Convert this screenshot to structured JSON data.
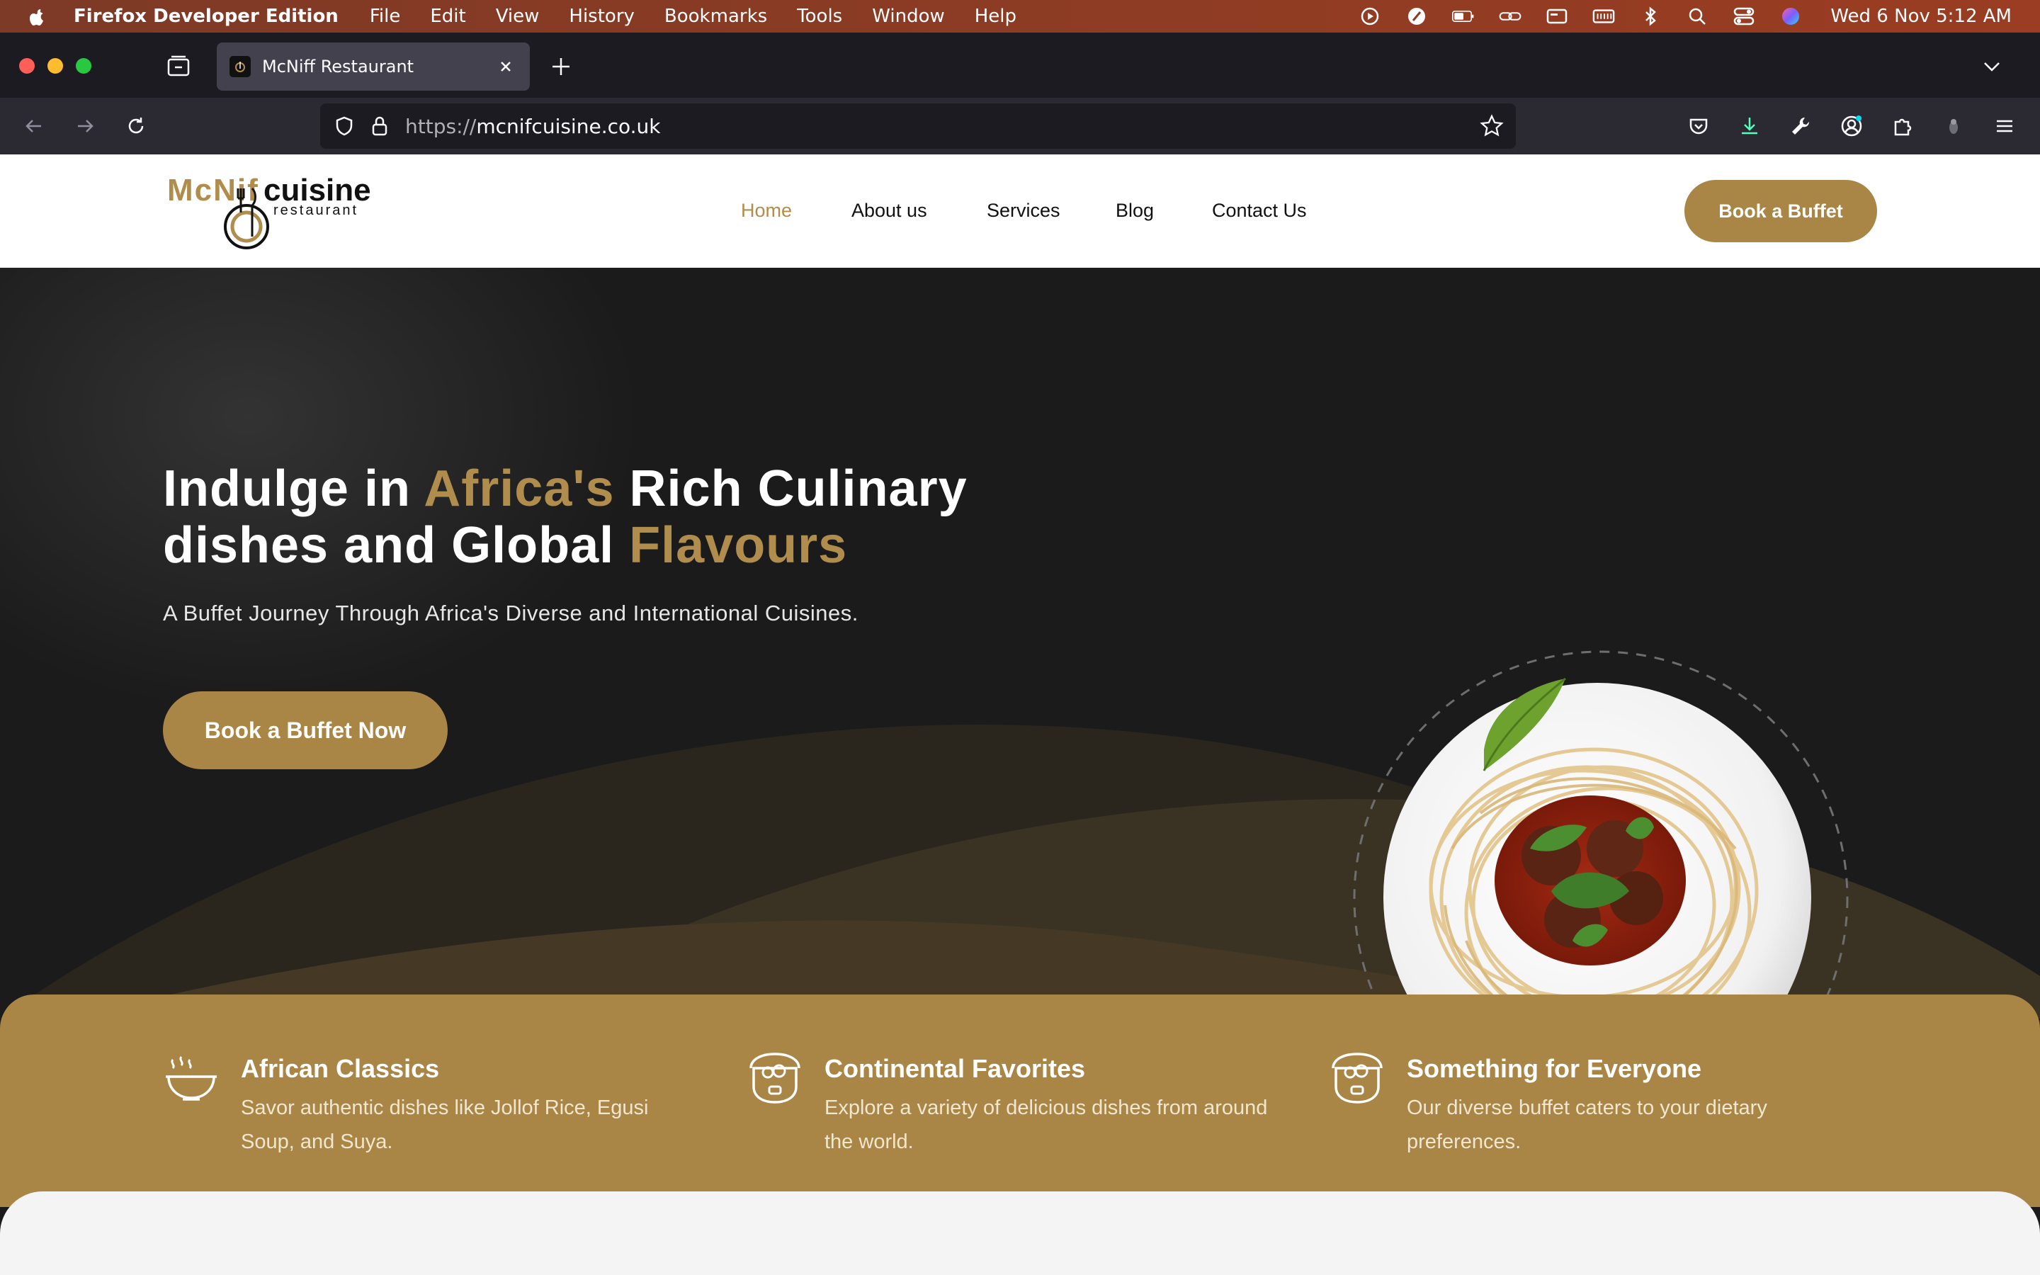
{
  "menubar": {
    "app_name": "Firefox Developer Edition",
    "items": [
      "File",
      "Edit",
      "View",
      "History",
      "Bookmarks",
      "Tools",
      "Window",
      "Help"
    ],
    "clock": "Wed 6 Nov  5:12 AM"
  },
  "browser": {
    "tab_title": "McNiff Restaurant",
    "url_protocol": "https://",
    "url_host": "mcnifcuisine.co.uk"
  },
  "site": {
    "logo": {
      "brand_part1": "McNif",
      "brand_part2": "cuisine",
      "tagline": "restaurant"
    },
    "nav": [
      "Home",
      "About us",
      "Services",
      "Blog",
      "Contact Us"
    ],
    "active_nav": "Home",
    "header_button": "Book a Buffet",
    "hero": {
      "title_part1": "Indulge in ",
      "title_gold1": "Africa's",
      "title_part2": " Rich Culinary",
      "title_part3": "dishes and Global ",
      "title_gold2": "Flavours",
      "subtitle": "A Buffet Journey Through Africa's Diverse and International Cuisines.",
      "button": "Book a Buffet Now"
    },
    "features": [
      {
        "icon": "bowl-icon",
        "title": "African Classics",
        "description": "Savor authentic dishes like Jollof Rice, Egusi Soup, and Suya."
      },
      {
        "icon": "food-box-icon",
        "title": "Continental Favorites",
        "description": "Explore a variety of delicious dishes from around the world."
      },
      {
        "icon": "food-box-icon",
        "title": "Something for Everyone",
        "description": "Our diverse buffet caters to your dietary preferences."
      }
    ]
  },
  "colors": {
    "brand_gold": "#a98645",
    "hero_bg": "#1b1b1b",
    "menubar_bg": "#8a3b24"
  }
}
